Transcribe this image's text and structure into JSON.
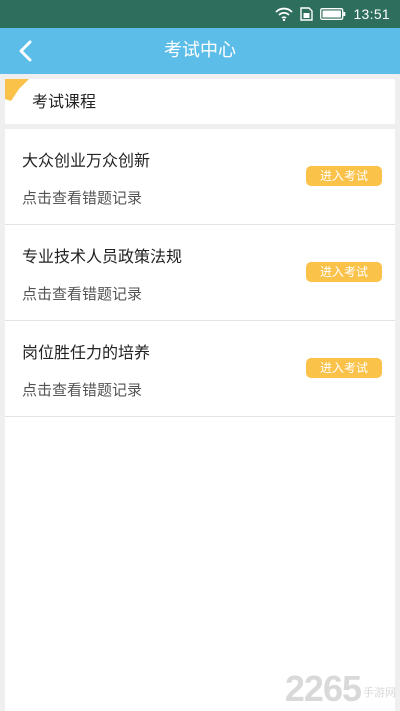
{
  "status_bar": {
    "time": "13:51",
    "icons": [
      "wifi-icon",
      "sim-card-icon",
      "battery-icon"
    ]
  },
  "nav": {
    "title": "考试中心",
    "back_icon": "chevron-left-icon"
  },
  "section": {
    "label": "考试课程"
  },
  "courses": [
    {
      "name": "大众创业万众创新",
      "link": "点击查看错题记录",
      "button": "进入考试"
    },
    {
      "name": "专业技术人员政策法规",
      "link": "点击查看错题记录",
      "button": "进入考试"
    },
    {
      "name": "岗位胜任力的培养",
      "link": "点击查看错题记录",
      "button": "进入考试"
    }
  ],
  "watermark": {
    "number": "2265",
    "suffix": "手游网"
  },
  "colors": {
    "status_bar": "#2e6e5c",
    "nav_bar": "#5dbde9",
    "button": "#fbc24a",
    "background": "#efefef"
  }
}
